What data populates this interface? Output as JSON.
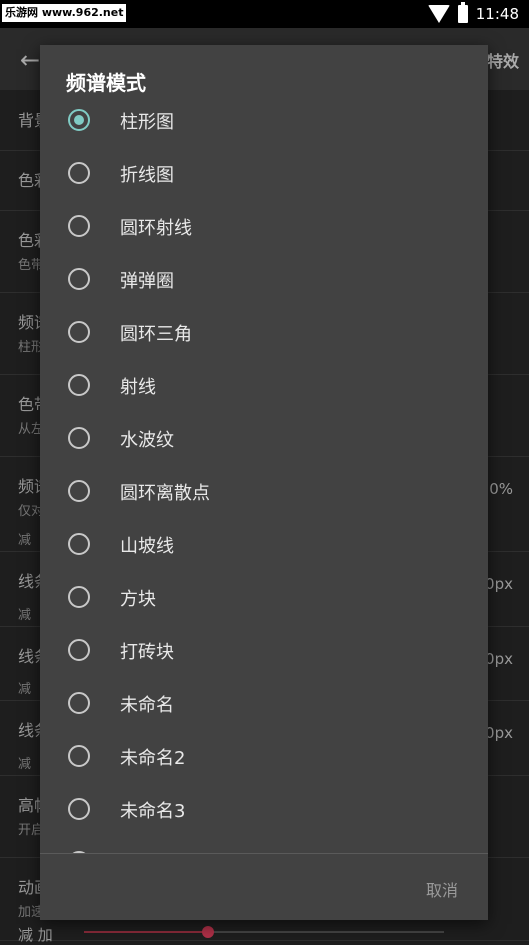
{
  "status": {
    "watermark": "乐游网 www.962.net",
    "time": "11:48"
  },
  "background": {
    "header_right": "特效",
    "rows": [
      {
        "title": "背景",
        "sub": "",
        "value": ""
      },
      {
        "title": "色彩",
        "sub": "",
        "value": ""
      },
      {
        "title": "色彩",
        "sub": "色带",
        "value": ""
      },
      {
        "title": "频谱",
        "sub": "柱形",
        "value": ""
      },
      {
        "title": "色带",
        "sub": "从左",
        "value": ""
      },
      {
        "title": "频谱",
        "sub": "仅对",
        "value": "0%",
        "minus": "减"
      },
      {
        "title": "线条",
        "sub": "",
        "value": "0px",
        "minus": "减"
      },
      {
        "title": "线条",
        "sub": "",
        "value": "0px",
        "minus": "减"
      },
      {
        "title": "线条",
        "sub": "",
        "value": "0px",
        "minus": "减"
      },
      {
        "title": "高帧",
        "sub": "开启",
        "value": ""
      },
      {
        "title": "动画",
        "sub": "加速",
        "value": ""
      }
    ],
    "bottom_controls": "减  加"
  },
  "dialog": {
    "title": "频谱模式",
    "options": [
      {
        "label": "柱形图",
        "checked": true
      },
      {
        "label": "折线图",
        "checked": false
      },
      {
        "label": "圆环射线",
        "checked": false
      },
      {
        "label": "弹弹圈",
        "checked": false
      },
      {
        "label": "圆环三角",
        "checked": false
      },
      {
        "label": "射线",
        "checked": false
      },
      {
        "label": "水波纹",
        "checked": false
      },
      {
        "label": "圆环离散点",
        "checked": false
      },
      {
        "label": "山坡线",
        "checked": false
      },
      {
        "label": "方块",
        "checked": false
      },
      {
        "label": "打砖块",
        "checked": false
      },
      {
        "label": "未命名",
        "checked": false
      },
      {
        "label": "未命名2",
        "checked": false
      },
      {
        "label": "未命名3",
        "checked": false
      },
      {
        "label": "",
        "checked": false
      }
    ],
    "button": "取消"
  }
}
